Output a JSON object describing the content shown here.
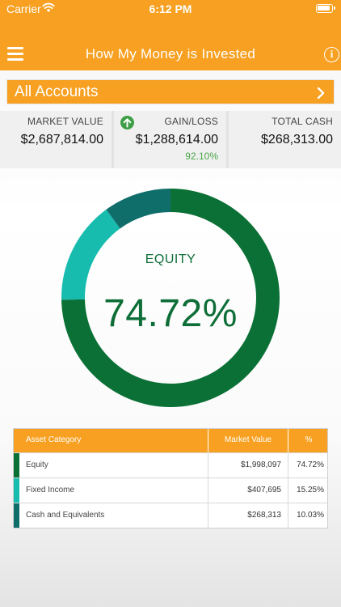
{
  "status_bar": {
    "carrier": "Carrier",
    "time": "6:12 PM"
  },
  "header": {
    "title": "How My Money is Invested"
  },
  "accounts": {
    "label": "All Accounts"
  },
  "summary": {
    "market_value": {
      "label": "MARKET VALUE",
      "value": "$2,687,814.00"
    },
    "gain_loss": {
      "label": "GAIN/LOSS",
      "value": "$1,288,614.00",
      "percent": "92.10%"
    },
    "total_cash": {
      "label": "TOTAL CASH",
      "value": "$268,313.00"
    }
  },
  "allocation": {
    "selected_label": "EQUITY",
    "selected_percent": "74.72%"
  },
  "chart_data": {
    "type": "pie",
    "categories": [
      "Equity",
      "Fixed Income",
      "Cash and Equivalents"
    ],
    "values": [
      74.72,
      15.25,
      10.03
    ],
    "colors": [
      "#0a7035",
      "#17bcae",
      "#0f6e6a"
    ]
  },
  "table": {
    "headers": {
      "category": "Asset Category",
      "market_value": "Market Value",
      "percent": "%"
    },
    "rows": [
      {
        "category": "Equity",
        "market_value": "$1,998,097",
        "percent": "74.72%",
        "color": "#0a7035"
      },
      {
        "category": "Fixed Income",
        "market_value": "$407,695",
        "percent": "15.25%",
        "color": "#17bcae"
      },
      {
        "category": "Cash and Equivalents",
        "market_value": "$268,313",
        "percent": "10.03%",
        "color": "#0f6e6a"
      }
    ]
  },
  "colors": {
    "brand_orange": "#f7a021",
    "equity_green": "#0d6e37",
    "gain_green": "#4aa54a"
  }
}
